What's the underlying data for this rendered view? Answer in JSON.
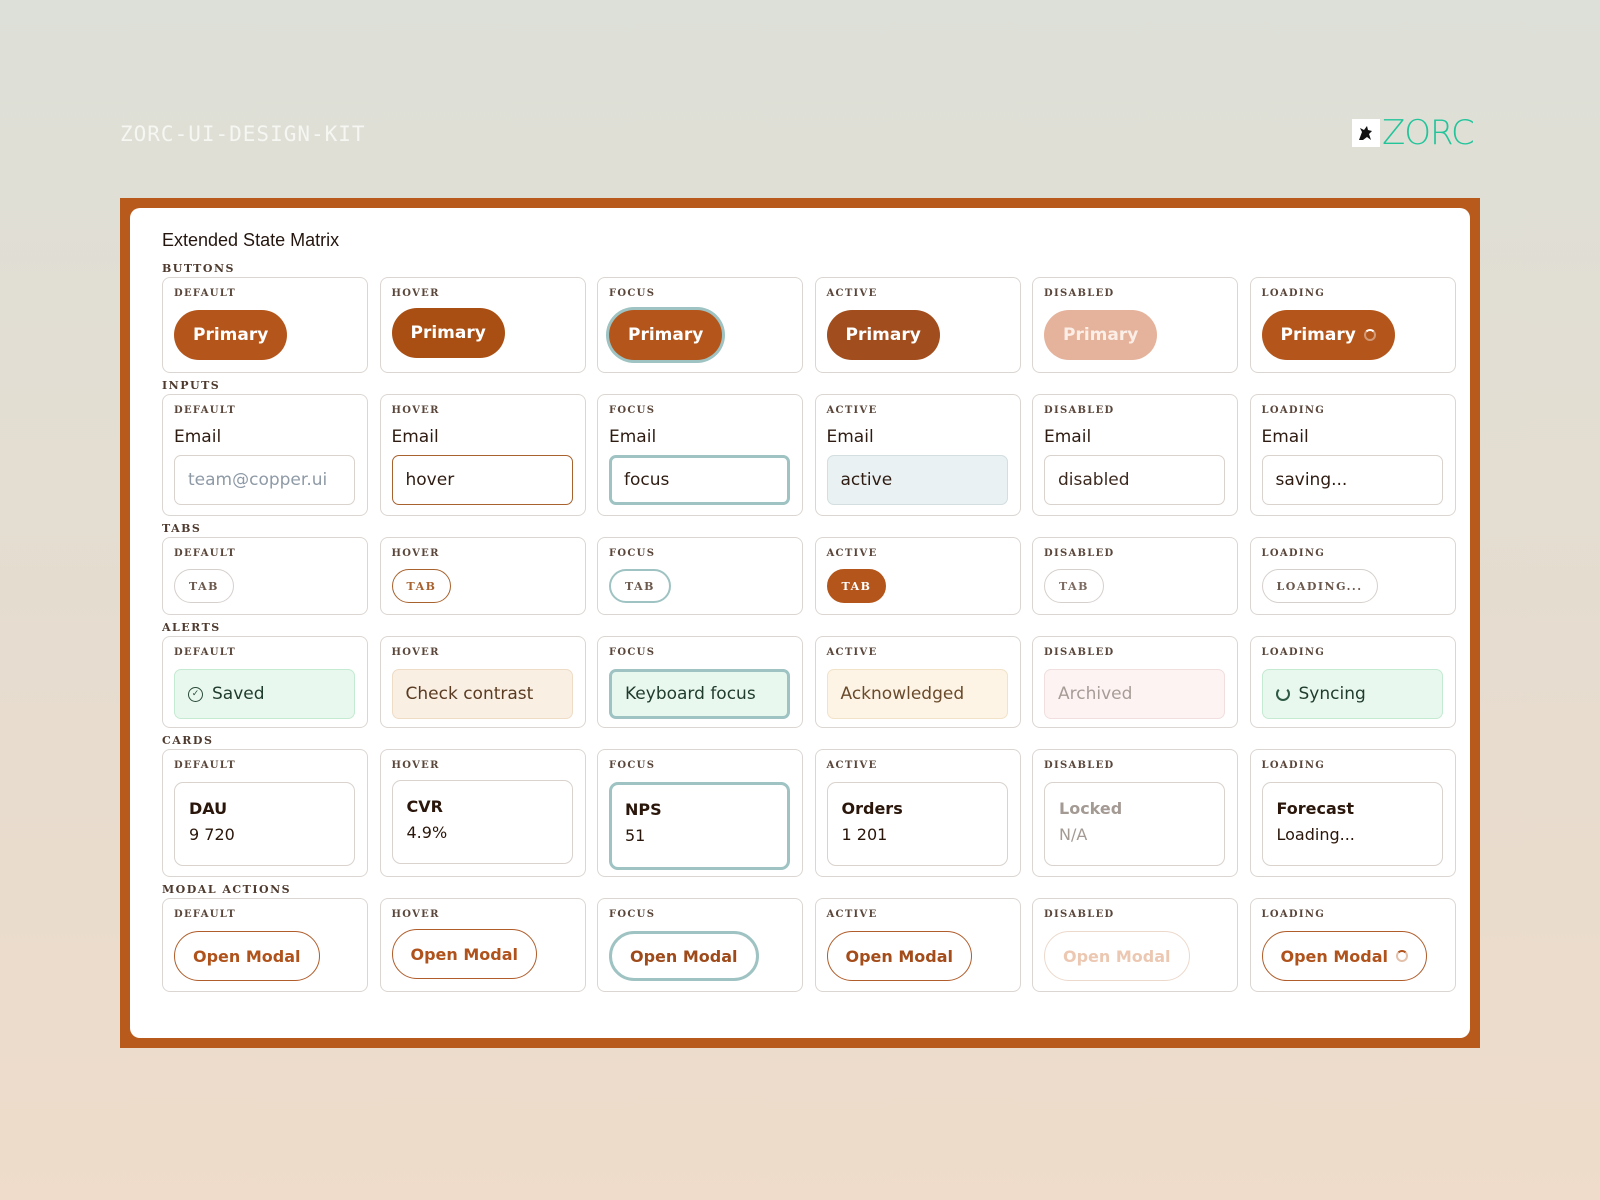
{
  "header": {
    "kit_label": "ZORC-UI-DESIGN-KIT",
    "brand": "ZORC",
    "brand_color": "#22c49a",
    "brand_icon": "dog-mascot-icon"
  },
  "frame_color": "#b95a1d",
  "panel": {
    "title": "Extended State Matrix"
  },
  "states": [
    "DEFAULT",
    "HOVER",
    "FOCUS",
    "ACTIVE",
    "DISABLED",
    "LOADING"
  ],
  "buttons": {
    "label": "BUTTONS",
    "button_label": "Primary",
    "accent": "#b4561b"
  },
  "inputs": {
    "label": "INPUTS",
    "field_label": "Email",
    "default_placeholder": "team@copper.ui",
    "values": {
      "hover": "hover",
      "focus": "focus",
      "active": "active",
      "disabled": "disabled",
      "loading": "saving..."
    }
  },
  "tabs": {
    "label": "TABS",
    "tab_label": "TAB",
    "loading_label": "LOADING..."
  },
  "alerts": {
    "label": "ALERTS",
    "default": "Saved",
    "hover": "Check contrast",
    "focus": "Keyboard focus",
    "active": "Acknowledged",
    "disabled": "Archived",
    "loading": "Syncing"
  },
  "cards": {
    "label": "CARDS",
    "items": [
      {
        "title": "DAU",
        "value": "9 720"
      },
      {
        "title": "CVR",
        "value": "4.9%"
      },
      {
        "title": "NPS",
        "value": "51"
      },
      {
        "title": "Orders",
        "value": "1 201"
      },
      {
        "title": "Locked",
        "value": "N/A"
      },
      {
        "title": "Forecast",
        "value": "Loading..."
      }
    ]
  },
  "modals": {
    "label": "MODAL ACTIONS",
    "button_label": "Open Modal"
  },
  "focus_ring_color": "#9ec3c2"
}
